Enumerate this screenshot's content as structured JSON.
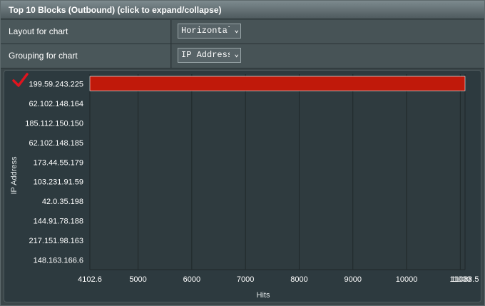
{
  "header": {
    "title": "Top 10 Blocks (Outbound) (click to expand/collapse)"
  },
  "layout_row": {
    "label": "Layout for chart",
    "value": "Horizontal"
  },
  "grouping_row": {
    "label": "Grouping for chart",
    "value": "IP Address"
  },
  "colors": {
    "bar": "#c0190a",
    "check": "#e0141e",
    "chart_bg": "#2d3a3f"
  },
  "chart_data": {
    "type": "bar",
    "orientation": "horizontal",
    "categories": [
      "199.59.243.225",
      "62.102.148.164",
      "185.112.150.150",
      "62.102.148.185",
      "173.44.55.179",
      "103.231.91.59",
      "42.0.35.198",
      "144.91.78.188",
      "217.151.98.163",
      "148.163.166.6"
    ],
    "values": [
      11088.5,
      0,
      0,
      0,
      0,
      0,
      0,
      0,
      0,
      0
    ],
    "xlim": [
      4102.6,
      11088.5
    ],
    "x_ticks": [
      4102.6,
      5000,
      6000,
      7000,
      8000,
      9000,
      10000,
      11000,
      11088.5
    ],
    "x_tick_labels": [
      "4102.6",
      "5000",
      "6000",
      "7000",
      "8000",
      "9000",
      "10000",
      "11000",
      "11088.5"
    ],
    "xlabel": "Hits",
    "ylabel": "IP Address",
    "grid": true
  }
}
